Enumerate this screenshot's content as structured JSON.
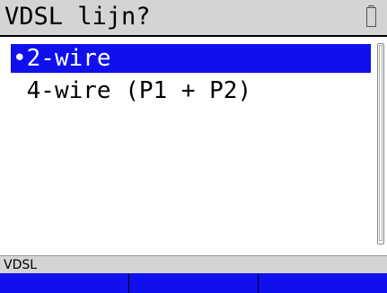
{
  "title": "VDSL lijn?",
  "options": [
    {
      "label": "•2-wire",
      "selected": true
    },
    {
      "label": " 4-wire (P1 + P2)",
      "selected": false
    }
  ],
  "status": "VDSL",
  "softkeys": [
    "",
    "",
    ""
  ],
  "colors": {
    "selection": "#1010ee",
    "softkey_bar": "#1010ee",
    "title_bar": "#d4d4d4",
    "status_bar": "#d4d4d4"
  },
  "icons": {
    "battery": "battery-icon"
  }
}
